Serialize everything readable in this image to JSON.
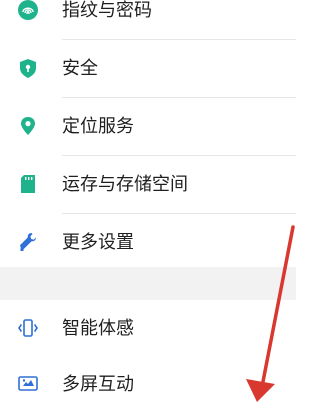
{
  "colors": {
    "icon_green": "#1fb38c",
    "icon_blue": "#2f6fd6",
    "arrow_red": "#d8382e"
  },
  "settings_items": [
    {
      "label": "指纹与密码",
      "icon": "fingerprint-icon"
    },
    {
      "label": "安全",
      "icon": "shield-icon"
    },
    {
      "label": "定位服务",
      "icon": "location-pin-icon"
    },
    {
      "label": "运存与存储空间",
      "icon": "sd-card-icon"
    },
    {
      "label": "更多设置",
      "icon": "wrench-icon"
    }
  ],
  "settings_items_2": [
    {
      "label": "智能体感",
      "icon": "phone-motion-icon"
    },
    {
      "label": "多屏互动",
      "icon": "screen-cast-icon"
    }
  ]
}
